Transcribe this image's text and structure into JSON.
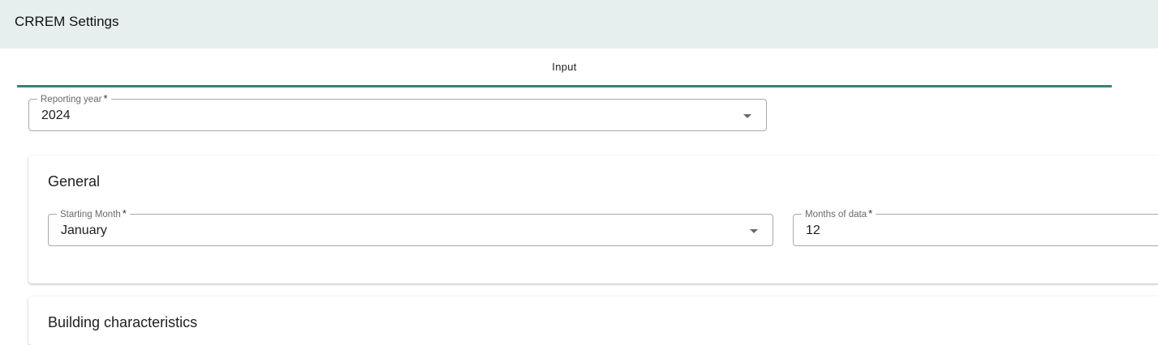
{
  "header": {
    "title": "CRREM Settings"
  },
  "tabs": [
    {
      "label": "Input",
      "active": true
    }
  ],
  "reporting_year": {
    "label": "Reporting year",
    "required_mark": "*",
    "value": "2024"
  },
  "general": {
    "title": "General",
    "starting_month": {
      "label": "Starting Month",
      "required_mark": "*",
      "value": "January"
    },
    "months_of_data": {
      "label": "Months of data",
      "required_mark": "*",
      "value": "12"
    }
  },
  "building": {
    "title": "Building characteristics"
  },
  "colors": {
    "header_bg": "#e6efee",
    "accent": "#3b7f7a"
  }
}
